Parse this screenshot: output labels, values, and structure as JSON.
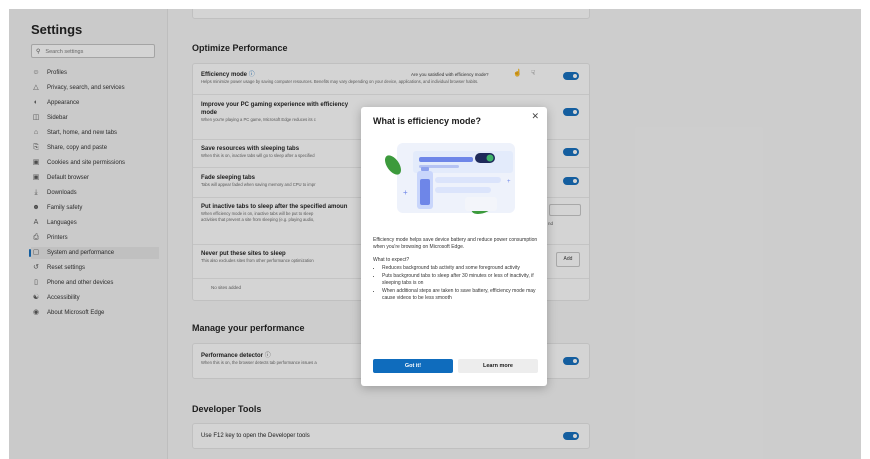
{
  "settings": {
    "title": "Settings",
    "search_placeholder": "Search settings",
    "nav": [
      {
        "label": "Profiles",
        "icon": "profile-icon"
      },
      {
        "label": "Privacy, search, and services",
        "icon": "lock-icon"
      },
      {
        "label": "Appearance",
        "icon": "appearance-icon"
      },
      {
        "label": "Sidebar",
        "icon": "sidebar-icon"
      },
      {
        "label": "Start, home, and new tabs",
        "icon": "home-icon"
      },
      {
        "label": "Share, copy and paste",
        "icon": "share-icon"
      },
      {
        "label": "Cookies and site permissions",
        "icon": "cookie-icon"
      },
      {
        "label": "Default browser",
        "icon": "browser-icon"
      },
      {
        "label": "Downloads",
        "icon": "download-icon"
      },
      {
        "label": "Family safety",
        "icon": "family-icon"
      },
      {
        "label": "Languages",
        "icon": "language-icon"
      },
      {
        "label": "Printers",
        "icon": "printer-icon"
      },
      {
        "label": "System and performance",
        "icon": "system-icon",
        "active": true
      },
      {
        "label": "Reset settings",
        "icon": "reset-icon"
      },
      {
        "label": "Phone and other devices",
        "icon": "phone-icon"
      },
      {
        "label": "Accessibility",
        "icon": "accessibility-icon"
      },
      {
        "label": "About Microsoft Edge",
        "icon": "edge-icon"
      }
    ]
  },
  "main": {
    "optimize_title": "Optimize Performance",
    "efficiency": {
      "title": "Efficiency mode",
      "desc": "Helps minimize power usage by saving computer resources. Benefits may vary depending on your device, applications, and individual browser habits.",
      "feedback": "Are you satisfied with efficiency mode?"
    },
    "gaming": {
      "title_line1": "Improve your PC gaming experience with efficiency",
      "title_line2": "mode",
      "desc": "When you're playing a PC game, Microsoft Edge reduces its c"
    },
    "sleeping": {
      "title": "Save resources with sleeping tabs",
      "desc": "When this is on, inactive tabs will go to sleep after a specified"
    },
    "fade": {
      "title": "Fade sleeping tabs",
      "desc": "Tabs will appear faded when saving memory and CPU to impr"
    },
    "inactive": {
      "title": "Put inactive tabs to sleep after the specified amoun",
      "desc_line1": "When efficiency mode is on, inactive tabs will be put to sleep",
      "desc_line2": "activities that prevent a site from sleeping (e.g. playing audio,",
      "dropdown_partial": "",
      "right_partial": "nd"
    },
    "never_sleep": {
      "title": "Never put these sites to sleep",
      "desc": "This also excludes sites from other performance optimization",
      "add_label": "Add",
      "empty": "No sites added"
    },
    "manage_title": "Manage your performance",
    "detector": {
      "title": "Performance detector",
      "desc": "When this is on, the browser detects tab performance issues a"
    },
    "dev_title": "Developer Tools",
    "f12": {
      "title": "Use F12 key to open the Developer tools"
    }
  },
  "modal": {
    "title": "What is efficiency mode?",
    "close": "✕",
    "intro": "Efficiency mode helps save device battery and reduce power consumption when you're browsing on Microsoft Edge.",
    "expect_label": "What to expect?",
    "bullets": [
      "Reduces background tab activity and some foreground activity",
      "Puts background tabs to sleep after 30 minutes or less of inactivity, if sleeping tabs is on",
      "When additional steps are taken to save battery, efficiency mode may cause videos to be less smooth"
    ],
    "got_it": "Got it!",
    "learn_more": "Learn more"
  },
  "colors": {
    "accent": "#0f6cbd",
    "leaf": "#3c9a3c",
    "illus_bar": "#6e86e8"
  }
}
